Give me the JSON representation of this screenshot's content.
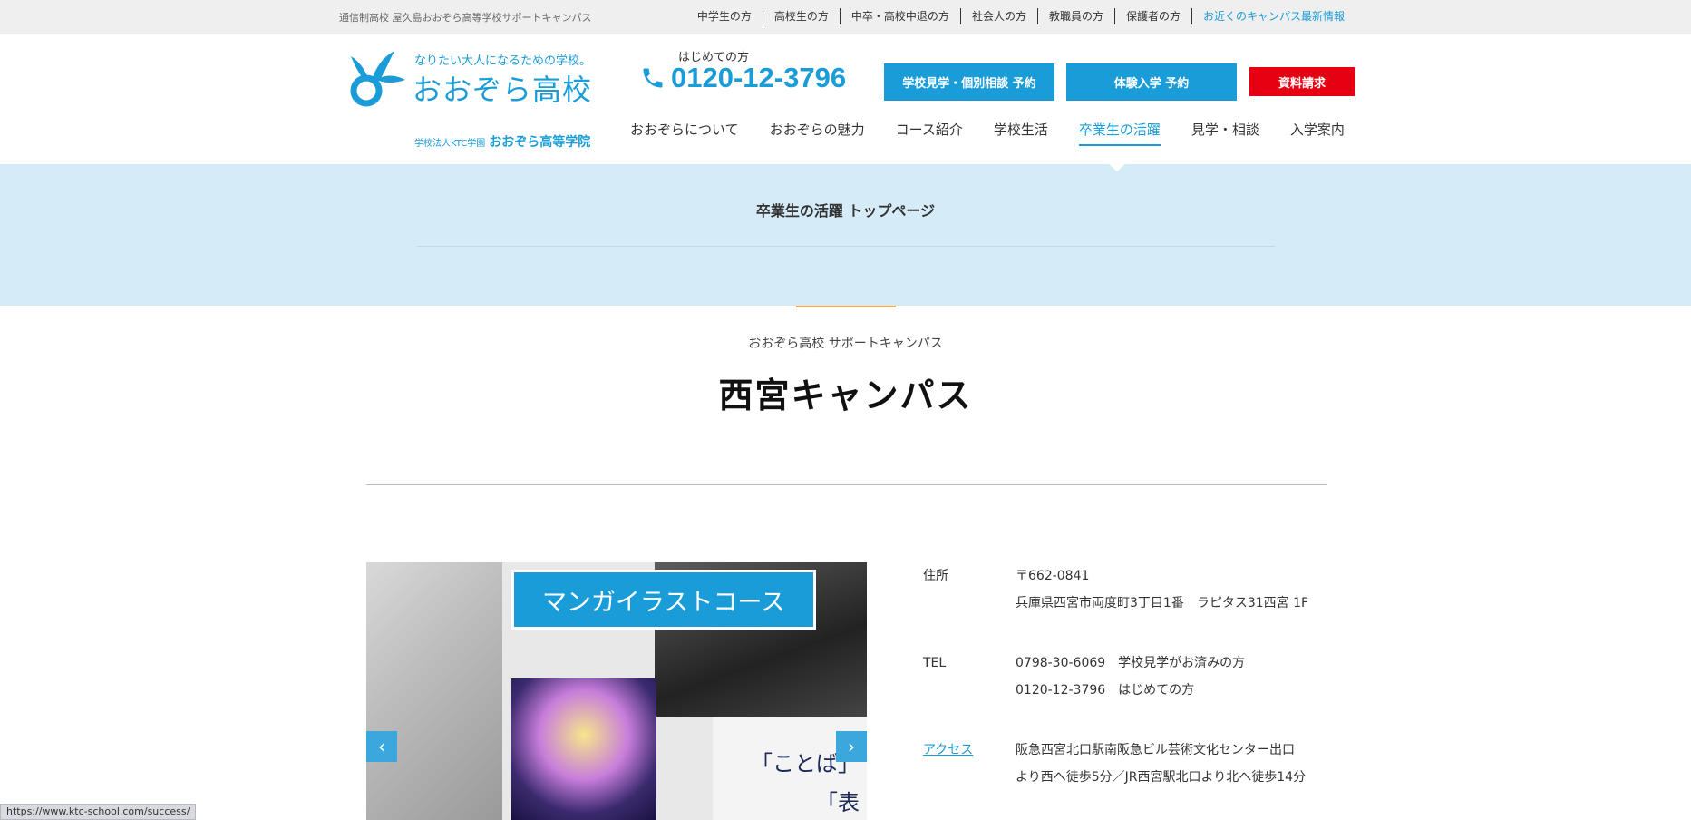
{
  "topbar": {
    "tagline": "通信制高校 屋久島おおぞら高等学校サポートキャンパス",
    "links": [
      "中学生の方",
      "高校生の方",
      "中卒・高校中退の方",
      "社会人の方",
      "教職員の方",
      "保護者の方",
      "お近くのキャンパス最新情報"
    ]
  },
  "header": {
    "logo_slogan": "なりたい大人になるための学校。",
    "logo_name": "おおぞら高校",
    "logo_corp_prefix": "学校法人KTC学園",
    "logo_corp_name": "おおぞら高等学院",
    "phone_label": "はじめての方",
    "phone_number": "0120-12-3796",
    "btn_visit": "学校見学・個別相談 予約",
    "btn_trial": "体験入学 予約",
    "btn_doc": "資料請求"
  },
  "mainnav": [
    "おおぞらについて",
    "おおぞらの魅力",
    "コース紹介",
    "学校生活",
    "卒業生の活躍",
    "見学・相談",
    "入学案内"
  ],
  "band": {
    "title": "卒業生の活躍 トップページ"
  },
  "campus": {
    "subtitle": "おおぞら高校 サポートキャンパス",
    "title": "西宮キャンパス"
  },
  "slider": {
    "banner": "マンガイラストコース",
    "quote1": "「ことば」",
    "quote2": "「表",
    "prev": "‹",
    "next": "›"
  },
  "info": {
    "address_label": "住所",
    "address_line1": "〒662-0841",
    "address_line2": "兵庫県西宮市両度町3丁目1番　ラピタス31西宮 1F",
    "tel_label": "TEL",
    "tel_line1": "0798-30-6069　学校見学がお済みの方",
    "tel_line2": "0120-12-3796　はじめての方",
    "access_label": "アクセス",
    "access_line1": "阪急西宮北口駅南阪急ビル芸術文化センター出口",
    "access_line2": "より西へ徒歩5分／JR西宮駅北口より北へ徒歩14分"
  },
  "status_url": "https://www.ktc-school.com/success/",
  "colors": {
    "brand_blue": "#1a9cd8",
    "band_blue": "#d5ecf8",
    "request_red": "#e60012",
    "accent_orange": "#f2a74b"
  }
}
